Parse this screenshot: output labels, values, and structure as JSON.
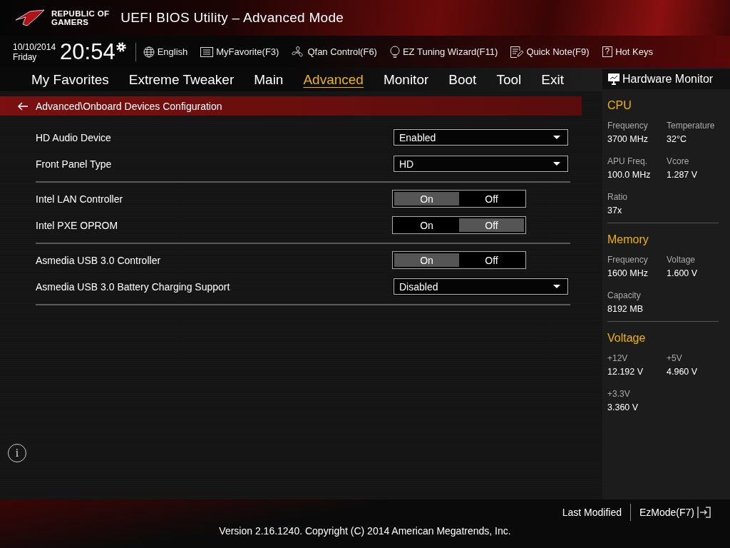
{
  "header": {
    "logo_lines": [
      "REPUBLIC OF",
      "GAMERS"
    ],
    "title": "UEFI BIOS Utility – Advanced Mode"
  },
  "toolbar": {
    "date": "10/10/2014",
    "day": "Friday",
    "time": "20:54",
    "items": [
      {
        "label": "English"
      },
      {
        "label": "MyFavorite(F3)"
      },
      {
        "label": "Qfan Control(F6)"
      },
      {
        "label": "EZ Tuning Wizard(F11)"
      },
      {
        "label": "Quick Note(F9)"
      },
      {
        "glyph": "?",
        "label": "Hot Keys"
      }
    ]
  },
  "tabs": [
    {
      "label": "My Favorites",
      "selected": false
    },
    {
      "label": "Extreme Tweaker",
      "selected": false
    },
    {
      "label": "Main",
      "selected": false
    },
    {
      "label": "Advanced",
      "selected": true
    },
    {
      "label": "Monitor",
      "selected": false
    },
    {
      "label": "Boot",
      "selected": false
    },
    {
      "label": "Tool",
      "selected": false
    },
    {
      "label": "Exit",
      "selected": false
    }
  ],
  "breadcrumb": "Advanced\\Onboard Devices Configuration",
  "settings": [
    {
      "items": [
        {
          "kind": "dropdown",
          "label": "HD Audio Device",
          "value": "Enabled"
        },
        {
          "kind": "dropdown",
          "label": "Front Panel Type",
          "value": "HD"
        }
      ]
    },
    {
      "items": [
        {
          "kind": "toggle",
          "label": "Intel LAN Controller",
          "options": [
            {
              "label": "On",
              "selected": true
            },
            {
              "label": "Off",
              "selected": false
            }
          ]
        },
        {
          "kind": "toggle",
          "label": "Intel PXE OPROM",
          "options": [
            {
              "label": "On",
              "selected": false
            },
            {
              "label": "Off",
              "selected": true
            }
          ]
        }
      ]
    },
    {
      "items": [
        {
          "kind": "toggle",
          "label": "Asmedia USB 3.0 Controller",
          "options": [
            {
              "label": "On",
              "selected": true
            },
            {
              "label": "Off",
              "selected": false
            }
          ]
        },
        {
          "kind": "dropdown",
          "label": "Asmedia USB 3.0 Battery Charging Support",
          "value": "Disabled"
        }
      ]
    }
  ],
  "info_glyph": "i",
  "hardware_monitor": {
    "title": "Hardware Monitor",
    "sections": [
      {
        "title": "CPU",
        "items": [
          {
            "label": "Frequency",
            "value": "3700 MHz"
          },
          {
            "label": "Temperature",
            "value": "32°C"
          },
          {
            "label": "APU Freq.",
            "value": "100.0 MHz"
          },
          {
            "label": "Vcore",
            "value": "1.287 V"
          },
          {
            "label": "Ratio",
            "value": "37x"
          }
        ]
      },
      {
        "title": "Memory",
        "items": [
          {
            "label": "Frequency",
            "value": "1600 MHz"
          },
          {
            "label": "Voltage",
            "value": "1.600 V"
          },
          {
            "label": "Capacity",
            "value": "8192 MB"
          }
        ]
      },
      {
        "title": "Voltage",
        "items": [
          {
            "label": "+12V",
            "value": "12.192 V"
          },
          {
            "label": "+5V",
            "value": "4.960 V"
          },
          {
            "label": "+3.3V",
            "value": "3.360 V"
          }
        ]
      }
    ]
  },
  "footer": {
    "last_modified": "Last Modified",
    "ez_mode": "EzMode(F7)",
    "copyright": "Version 2.16.1240. Copyright (C) 2014 American Megatrends, Inc."
  }
}
